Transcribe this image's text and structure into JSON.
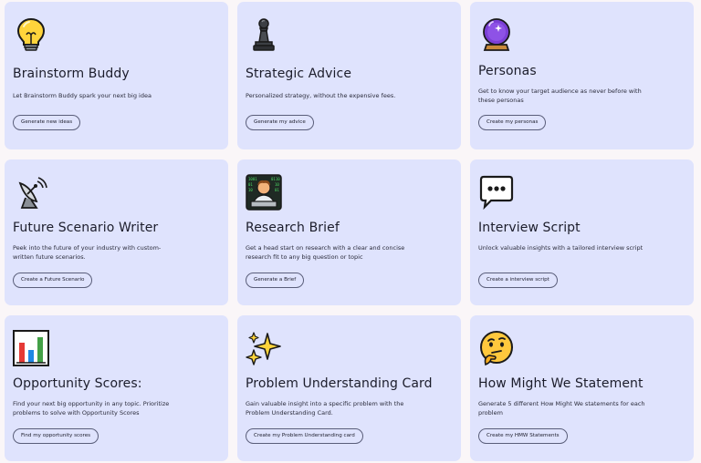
{
  "cards": [
    {
      "title": "Brainstorm Buddy",
      "description": "Let Brainstorm Buddy spark your next big idea",
      "button": "Generate new ideas",
      "icon": "light-bulb-icon"
    },
    {
      "title": "Strategic Advice",
      "description": "Personalized strategy, without the expensive fees.",
      "button": "Generate my advice",
      "icon": "chess-pawn-icon"
    },
    {
      "title": "Personas",
      "description": "Get to know your target audience as never before with these personas",
      "button": "Create my personas",
      "icon": "crystal-ball-icon"
    },
    {
      "title": "Future Scenario Writer",
      "description": "Peek into the future of your industry with custom-written future scenarios.",
      "button": "Create a Future Scenario",
      "icon": "satellite-antenna-icon"
    },
    {
      "title": "Research Brief",
      "description": "Get a head start on research with a clear and concise research fit to any big question or topic",
      "button": "Generate a Brief",
      "icon": "technologist-icon"
    },
    {
      "title": "Interview Script",
      "description": "Unlock valuable insights with a tailored interview script",
      "button": "Create a interview script",
      "icon": "speech-balloon-icon"
    },
    {
      "title": "Opportunity Scores:",
      "description": "Find your next big opportunity in any topic. Prioritize problems to solve with Opportunity Scores",
      "button": "Find my opportunity scores",
      "icon": "bar-chart-icon"
    },
    {
      "title": "Problem Understanding Card",
      "description": "Gain valuable insight into a specific problem with the Problem Understanding Card.",
      "button": "Create my Problem Understanding card",
      "icon": "sparkles-icon"
    },
    {
      "title": "How Might We Statement",
      "description": "Generate 5 different How Might We statements for each problem",
      "button": "Create my HMW Statements",
      "icon": "thinking-face-icon"
    }
  ]
}
